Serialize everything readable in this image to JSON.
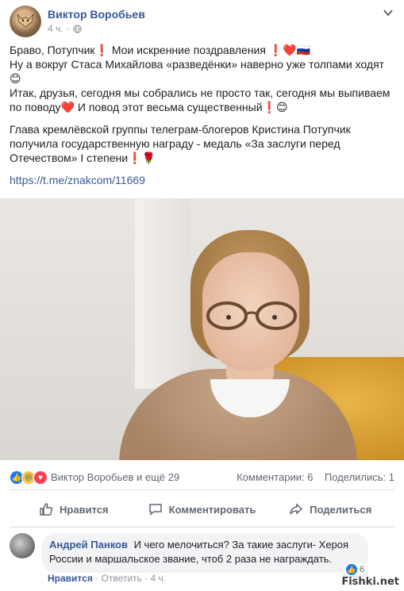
{
  "post": {
    "author": "Виктор Воробьев",
    "time": "4 ч.",
    "lines": [
      "Браво, Потупчик❗ Мои искренние поздравления ❗❤️🇷🇺",
      "Ну а вокруг Стаса Михайлова «разведёнки» наверно уже толпами ходят😊",
      "Итак, друзья, сегодня мы собрались не просто так, сегодня мы выпиваем по поводу❤️ И повод этот весьма существенный❗😊"
    ],
    "paragraph2": "Глава кремлёвской группы телеграм-блогеров Кристина Потупчик получила государственную награду - медаль «За заслуги перед Отечеством» I степени❗🌹",
    "link": "https://t.me/znakcom/11669"
  },
  "reactions": {
    "names": "Виктор Воробьев и ещё 29",
    "comments": "Комментарии: 6",
    "shares": "Поделились: 1"
  },
  "actions": {
    "like": "Нравится",
    "comment": "Комментировать",
    "share": "Поделиться"
  },
  "comment": {
    "author": "Андрей Панков",
    "text": "И чего мелочиться? За такие заслуги- Хероя России и маршальское звание, чтоб 2 раза не награждать.",
    "reaction_count": "6",
    "like_label": "Нравится",
    "reply_label": "Ответить",
    "time": "4 ч."
  },
  "icons": {
    "globe": "globe-icon",
    "chevron": "chevron-down-icon",
    "like": "thumbs-up-icon",
    "comment": "speech-bubble-icon",
    "share": "share-arrow-icon"
  },
  "colors": {
    "link": "#385898",
    "like_blue": "#1877f2",
    "love_red": "#f33e58"
  },
  "watermark": "Fishki.net"
}
